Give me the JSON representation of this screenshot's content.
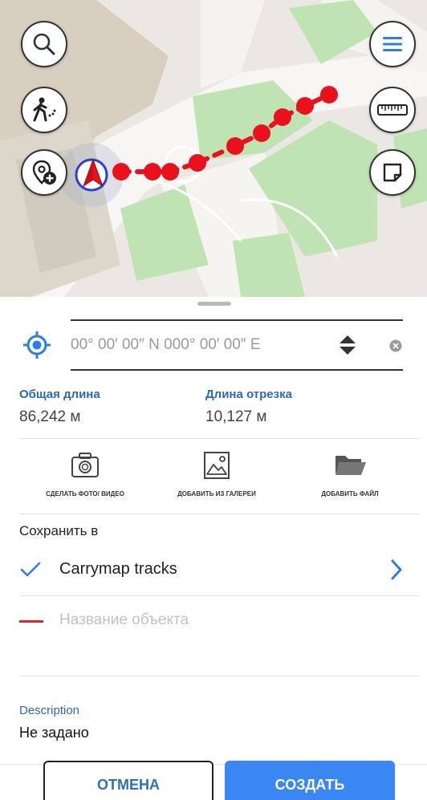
{
  "map": {
    "buttons": {
      "search": "search-icon",
      "menu": "menu-icon",
      "walk_track": "walking-track-icon",
      "ruler": "ruler-icon",
      "add_point": "add-location-icon",
      "layer": "note-icon"
    }
  },
  "coordinates": {
    "value": "00° 00′ 00″ N 000° 00′ 00″ E"
  },
  "metrics": {
    "total_length_label": "Общая длина",
    "total_length_value": "86,242 м",
    "segment_length_label": "Длина отрезка",
    "segment_length_value": "10,127 м"
  },
  "actions": {
    "photo_label": "СДЕЛАТЬ ФОТО/ ВИДЕО",
    "gallery_label": "ДОБАВИТЬ ИЗ ГАЛЕРЕИ",
    "file_label": "ДОБАВИТЬ ФАЙЛ"
  },
  "save": {
    "label": "Сохранить в",
    "target": "Carrymap tracks"
  },
  "object": {
    "name_placeholder": "Название объекта",
    "line_color": "#d62b2b"
  },
  "description": {
    "label": "Description",
    "value": "Не задано"
  },
  "buttons": {
    "cancel": "ОТМЕНА",
    "create": "СОЗДАТЬ"
  },
  "colors": {
    "accent": "#3a86f2",
    "label_blue": "#2b6ab7",
    "track_red": "#e8111c"
  }
}
